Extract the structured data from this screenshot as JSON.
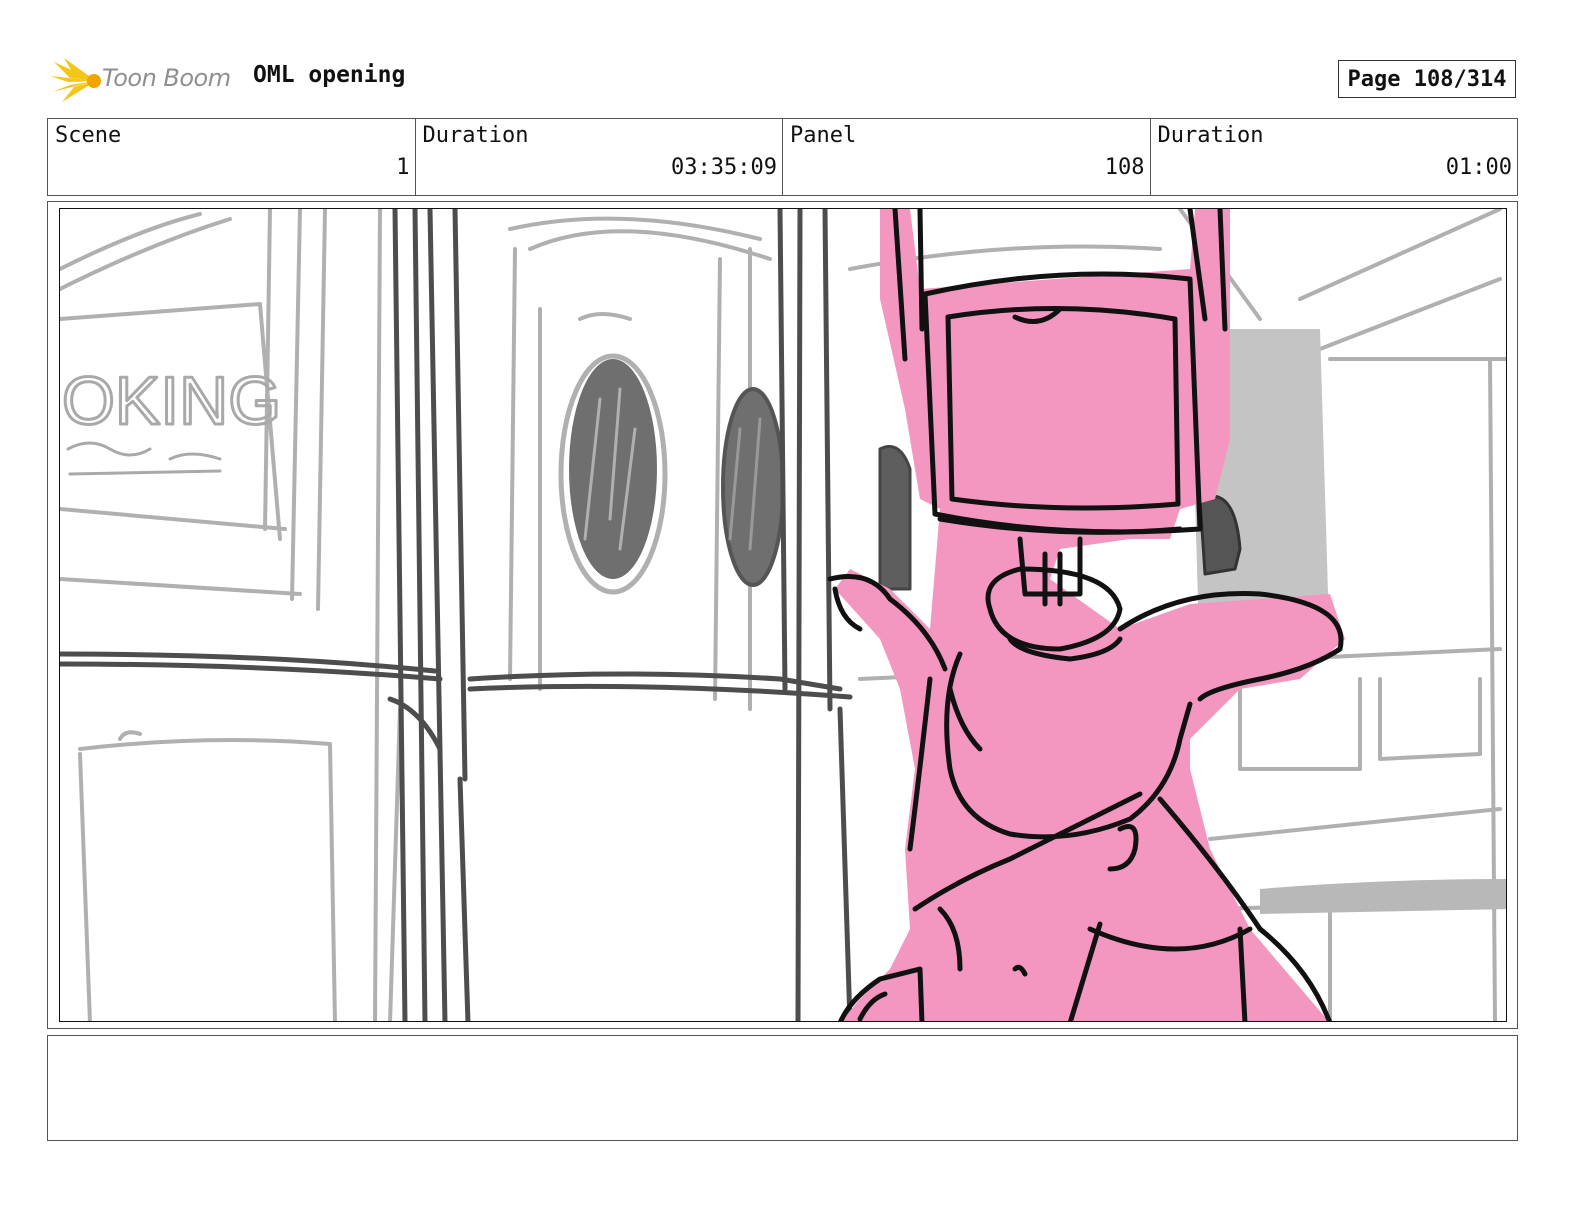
{
  "header": {
    "logo_text": "Toon Boom",
    "project_title": "OML opening",
    "page_label": "Page 108/314"
  },
  "info": {
    "scene_label": "Scene",
    "scene_value": "1",
    "scene_duration_label": "Duration",
    "scene_duration_value": "03:35:09",
    "panel_label": "Panel",
    "panel_value": "108",
    "panel_duration_label": "Duration",
    "panel_duration_value": "01:00"
  },
  "sketch": {
    "sign_text": "OKING"
  },
  "colors": {
    "character_pink": "#f497c0",
    "sketch_dark": "#555555",
    "sketch_light": "#a9a9a9",
    "logo_yellow": "#f5c518"
  },
  "caption": ""
}
